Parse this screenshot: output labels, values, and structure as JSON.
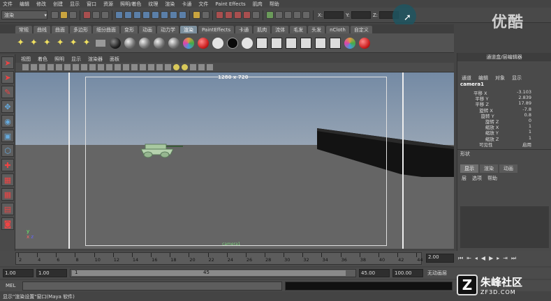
{
  "menubar": {
    "items": [
      "文件",
      "编辑",
      "修改",
      "创建",
      "显示",
      "窗口",
      "资源",
      "照明/着色",
      "纹理",
      "渲染",
      "卡通",
      "文件",
      "Paint Effects",
      "肌肉",
      "帮助"
    ]
  },
  "statusline": {
    "mode": "渲染",
    "coord_labels": {
      "x": "X:",
      "y": "Y:",
      "z": "Z:"
    }
  },
  "watermark_top": "优酷",
  "shelf_tabs": [
    "常规",
    "曲线",
    "曲面",
    "多边形",
    "细分曲面",
    "变形",
    "动画",
    "动力学",
    "渲染",
    "PaintEffects",
    "卡通",
    "肌肉",
    "流体",
    "毛发",
    "头发",
    "nCloth",
    "自定义"
  ],
  "shelf_active_index": 8,
  "panel_menu": [
    "视图",
    "着色",
    "照明",
    "显示",
    "渲染器",
    "面板"
  ],
  "viewport": {
    "resolution": "1280 x 720",
    "persp_label": "camera1"
  },
  "channel_box": {
    "title": "通道盒/层编辑器",
    "menu": [
      "通道",
      "编辑",
      "对象",
      "显示"
    ],
    "object": "camera1",
    "attrs": [
      {
        "label": "平移 X",
        "value": "-3.103"
      },
      {
        "label": "平移 Y",
        "value": "2.839"
      },
      {
        "label": "平移 Z",
        "value": "17.89"
      },
      {
        "label": "旋转 X",
        "value": "-7.8"
      },
      {
        "label": "旋转 Y",
        "value": "0.8"
      },
      {
        "label": "旋转 Z",
        "value": "0"
      },
      {
        "label": "缩放 X",
        "value": "1"
      },
      {
        "label": "缩放 Y",
        "value": "1"
      },
      {
        "label": "缩放 Z",
        "value": "1"
      },
      {
        "label": "可见性",
        "value": "启用"
      }
    ],
    "shapes_label": "形状",
    "layer_tabs": [
      "显示",
      "渲染",
      "动画"
    ],
    "layer_active_index": 0,
    "layer_menu": [
      "层",
      "选项",
      "帮助"
    ]
  },
  "timeline": {
    "ticks": [
      "2",
      "4",
      "6",
      "8",
      "10",
      "12",
      "14",
      "16",
      "18",
      "20",
      "22",
      "24",
      "26",
      "28",
      "30",
      "32",
      "34",
      "36",
      "38",
      "40",
      "42",
      "44"
    ],
    "current_frame_marker": "2",
    "current_frame": "2.00"
  },
  "range": {
    "start": "1.00",
    "playback_start": "1.00",
    "slider_start": "1",
    "slider_end": "45",
    "playback_end": "45.00",
    "end": "100.00",
    "anim_layer": "无动画层"
  },
  "cmdline": {
    "label": "MEL"
  },
  "helpline": "显示\"渲染设置\"窗口(Maya 软件)",
  "watermark_bottom": {
    "name": "朱峰社区",
    "url": "ZF3D.COM"
  }
}
